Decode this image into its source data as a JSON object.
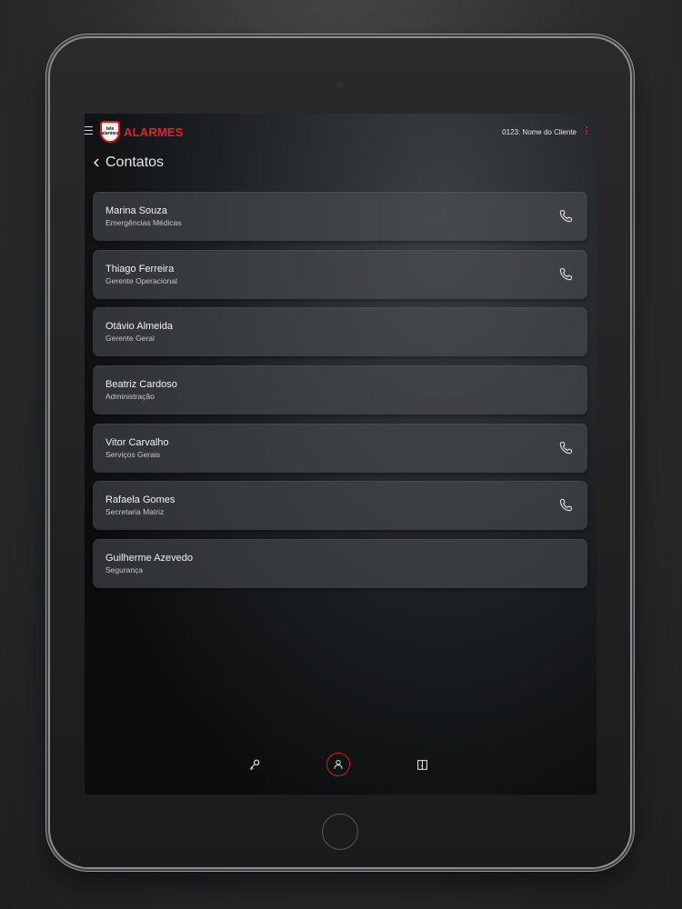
{
  "app": {
    "logo_small_text_1": "tele",
    "logo_small_text_2": "alarmes",
    "brand": "ALARMES",
    "client_label": "0123: Nome do Cliente"
  },
  "page": {
    "title": "Contatos"
  },
  "contacts": [
    {
      "name": "Marina Souza",
      "role": "Emergências Médicas",
      "has_phone": true
    },
    {
      "name": "Thiago Ferreira",
      "role": "Gerente Operacional",
      "has_phone": true
    },
    {
      "name": "Otávio Almeida",
      "role": "Gerente Geral",
      "has_phone": false
    },
    {
      "name": "Beatriz Cardoso",
      "role": "Administração",
      "has_phone": false
    },
    {
      "name": "Vitor Carvalho",
      "role": "Serviços Gerais",
      "has_phone": true
    },
    {
      "name": "Rafaela Gomes",
      "role": "Secretaria Matriz",
      "has_phone": true
    },
    {
      "name": "Guilherme Azevedo",
      "role": "Segurança",
      "has_phone": false
    }
  ],
  "bottom_nav": [
    {
      "icon": "key-icon",
      "active": false
    },
    {
      "icon": "person-icon",
      "active": true
    },
    {
      "icon": "door-icon",
      "active": false
    }
  ],
  "colors": {
    "accent": "#d71920",
    "text": "#f2f2f2",
    "card": "#4e5256"
  }
}
